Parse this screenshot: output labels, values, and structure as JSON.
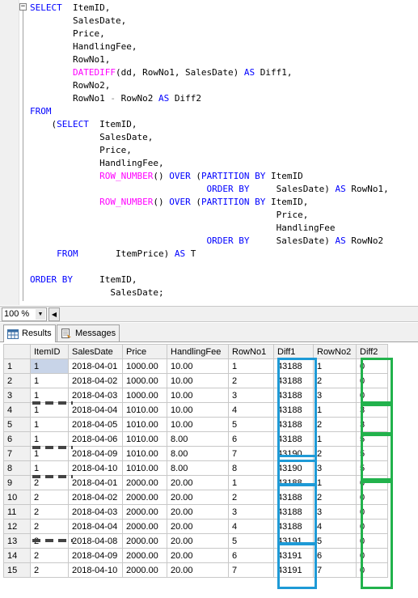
{
  "editor": {
    "lines": [
      [
        {
          "t": "SELECT",
          "c": "kw"
        },
        {
          "t": "  ItemID,"
        }
      ],
      [
        {
          "t": "        SalesDate,"
        }
      ],
      [
        {
          "t": "        Price,"
        }
      ],
      [
        {
          "t": "        HandlingFee,"
        }
      ],
      [
        {
          "t": "        RowNo1,"
        }
      ],
      [
        {
          "t": "        "
        },
        {
          "t": "DATEDIFF",
          "c": "fn"
        },
        {
          "t": "(dd, RowNo1, SalesDate) "
        },
        {
          "t": "AS",
          "c": "kw"
        },
        {
          "t": " Diff1,"
        }
      ],
      [
        {
          "t": "        RowNo2,"
        }
      ],
      [
        {
          "t": "        RowNo1 "
        },
        {
          "t": "-",
          "c": "gr"
        },
        {
          "t": " RowNo2 "
        },
        {
          "t": "AS",
          "c": "kw"
        },
        {
          "t": " Diff2"
        }
      ],
      [
        {
          "t": "FROM",
          "c": "kw"
        }
      ],
      [
        {
          "t": "    ("
        },
        {
          "t": "SELECT",
          "c": "kw"
        },
        {
          "t": "  ItemID,"
        }
      ],
      [
        {
          "t": "             SalesDate,"
        }
      ],
      [
        {
          "t": "             Price,"
        }
      ],
      [
        {
          "t": "             HandlingFee,"
        }
      ],
      [
        {
          "t": "             "
        },
        {
          "t": "ROW_NUMBER",
          "c": "fn"
        },
        {
          "t": "() "
        },
        {
          "t": "OVER",
          "c": "kw"
        },
        {
          "t": " ("
        },
        {
          "t": "PARTITION BY",
          "c": "kw"
        },
        {
          "t": " ItemID"
        }
      ],
      [
        {
          "t": "                                 "
        },
        {
          "t": "ORDER BY",
          "c": "kw"
        },
        {
          "t": "     SalesDate) "
        },
        {
          "t": "AS",
          "c": "kw"
        },
        {
          "t": " RowNo1,"
        }
      ],
      [
        {
          "t": "             "
        },
        {
          "t": "ROW_NUMBER",
          "c": "fn"
        },
        {
          "t": "() "
        },
        {
          "t": "OVER",
          "c": "kw"
        },
        {
          "t": " ("
        },
        {
          "t": "PARTITION BY",
          "c": "kw"
        },
        {
          "t": " ItemID,"
        }
      ],
      [
        {
          "t": "                                              Price,"
        }
      ],
      [
        {
          "t": "                                              HandlingFee"
        }
      ],
      [
        {
          "t": "                                 "
        },
        {
          "t": "ORDER BY",
          "c": "kw"
        },
        {
          "t": "     SalesDate) "
        },
        {
          "t": "AS",
          "c": "kw"
        },
        {
          "t": " RowNo2"
        }
      ],
      [
        {
          "t": "     "
        },
        {
          "t": "FROM",
          "c": "kw"
        },
        {
          "t": "       ItemPrice) "
        },
        {
          "t": "AS",
          "c": "kw"
        },
        {
          "t": " T"
        }
      ],
      [
        {
          "t": ""
        }
      ],
      [
        {
          "t": "ORDER BY",
          "c": "kw"
        },
        {
          "t": "     ItemID,"
        }
      ],
      [
        {
          "t": "               SalesDate;"
        }
      ]
    ]
  },
  "zoom": {
    "value": "100 %"
  },
  "tabs": {
    "results": "Results",
    "messages": "Messages"
  },
  "grid": {
    "columns": [
      "",
      "ItemID",
      "SalesDate",
      "Price",
      "HandlingFee",
      "RowNo1",
      "Diff1",
      "RowNo2",
      "Diff2"
    ],
    "rows": [
      [
        "1",
        "1",
        "2018-04-01",
        "1000.00",
        "10.00",
        "1",
        "43188",
        "1",
        "0"
      ],
      [
        "2",
        "1",
        "2018-04-02",
        "1000.00",
        "10.00",
        "2",
        "43188",
        "2",
        "0"
      ],
      [
        "3",
        "1",
        "2018-04-03",
        "1000.00",
        "10.00",
        "3",
        "43188",
        "3",
        "0"
      ],
      [
        "4",
        "1",
        "2018-04-04",
        "1010.00",
        "10.00",
        "4",
        "43188",
        "1",
        "3"
      ],
      [
        "5",
        "1",
        "2018-04-05",
        "1010.00",
        "10.00",
        "5",
        "43188",
        "2",
        "3"
      ],
      [
        "6",
        "1",
        "2018-04-06",
        "1010.00",
        "8.00",
        "6",
        "43188",
        "1",
        "5"
      ],
      [
        "7",
        "1",
        "2018-04-09",
        "1010.00",
        "8.00",
        "7",
        "43190",
        "2",
        "5"
      ],
      [
        "8",
        "1",
        "2018-04-10",
        "1010.00",
        "8.00",
        "8",
        "43190",
        "3",
        "5"
      ],
      [
        "9",
        "2",
        "2018-04-01",
        "2000.00",
        "20.00",
        "1",
        "43188",
        "1",
        "0"
      ],
      [
        "10",
        "2",
        "2018-04-02",
        "2000.00",
        "20.00",
        "2",
        "43188",
        "2",
        "0"
      ],
      [
        "11",
        "2",
        "2018-04-03",
        "2000.00",
        "20.00",
        "3",
        "43188",
        "3",
        "0"
      ],
      [
        "12",
        "2",
        "2018-04-04",
        "2000.00",
        "20.00",
        "4",
        "43188",
        "4",
        "0"
      ],
      [
        "13",
        "2",
        "2018-04-08",
        "2000.00",
        "20.00",
        "5",
        "43191",
        "5",
        "0"
      ],
      [
        "14",
        "2",
        "2018-04-09",
        "2000.00",
        "20.00",
        "6",
        "43191",
        "6",
        "0"
      ],
      [
        "15",
        "2",
        "2018-04-10",
        "2000.00",
        "20.00",
        "7",
        "43191",
        "7",
        "0"
      ]
    ]
  },
  "colors": {
    "keyword": "#0000ff",
    "function": "#ff00ff",
    "highlight_blue": "#1e9ad6",
    "highlight_green": "#22b24c"
  }
}
